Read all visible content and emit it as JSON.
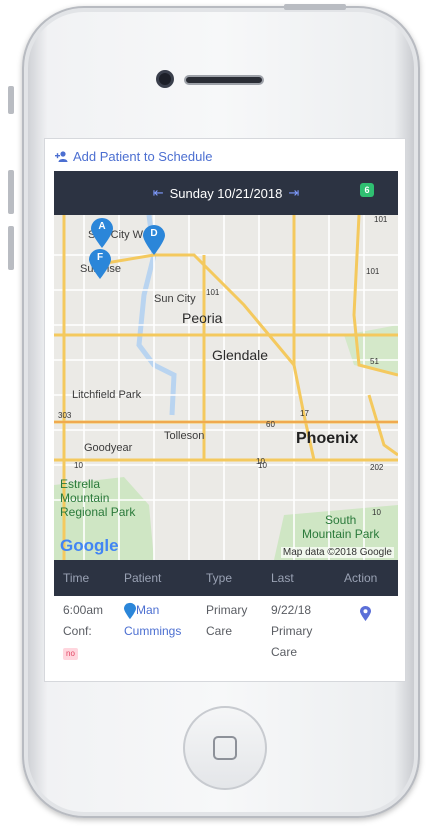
{
  "header": {
    "add_patient_label": "Add Patient to Schedule"
  },
  "date_bar": {
    "date_label": "Sunday 10/21/2018",
    "prev_arrow": "⇤",
    "next_arrow": "⇥",
    "count_badge": "6"
  },
  "map": {
    "labels": {
      "sun_city_west": "Sun City W",
      "surprise": "Surprise",
      "sun_city": "Sun City",
      "peoria": "Peoria",
      "glendale": "Glendale",
      "litchfield_park": "Litchfield Park",
      "tolleson": "Tolleson",
      "phoenix": "Phoenix",
      "goodyear": "Goodyear",
      "estrella": "Estrella\nMountain\nRegional Park",
      "south_mountain": "South\nMountain Park"
    },
    "shields": {
      "r101a": "101",
      "r101b": "101",
      "r101c": "101",
      "r51": "51",
      "r303": "303",
      "r60": "60",
      "r17": "17",
      "r10a": "10",
      "r10b": "10",
      "r10c": "10",
      "r10d": "10",
      "r202": "202"
    },
    "markers": {
      "a": "A",
      "d": "D",
      "f": "F"
    },
    "google_logo": "Google",
    "credit": "Map data ©2018 Google"
  },
  "table": {
    "columns": [
      "Time",
      "Patient",
      "Type",
      "Last",
      "Action"
    ],
    "rows": [
      {
        "time": "6:00am",
        "conf_label": "Conf:",
        "conf_value": "no",
        "patient_first": "Man",
        "patient_last": "Cummings",
        "type_line1": "Primary",
        "type_line2": "Care",
        "last_date": "9/22/18",
        "last_line2": "Primary",
        "last_line3": "Care"
      }
    ]
  },
  "colors": {
    "accent": "#4c6fd1",
    "bar": "#2c3342",
    "badge": "#2fbf71",
    "marker": "#2b86d9",
    "pill_bg": "#ffd6de",
    "pill_text": "#e14764"
  }
}
